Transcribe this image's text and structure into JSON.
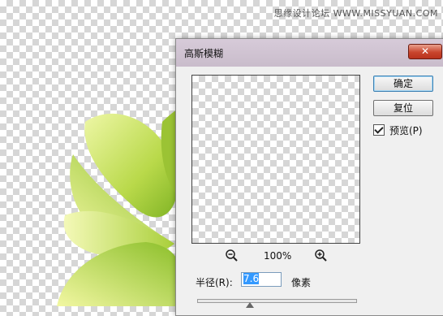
{
  "watermark": "思缘设计论坛 WWW.MISSYUAN.COM",
  "dialog": {
    "title": "高斯模糊",
    "close_glyph": "✕",
    "ok_label": "确定",
    "reset_label": "复位",
    "preview_label": "预览(P)",
    "preview_checked": true,
    "zoom_level": "100%",
    "radius_label": "半径(R):",
    "radius_value": "7.6",
    "radius_unit": "像素",
    "icons": [
      "zoom-out-icon",
      "zoom-in-icon",
      "checkmark-icon"
    ]
  }
}
